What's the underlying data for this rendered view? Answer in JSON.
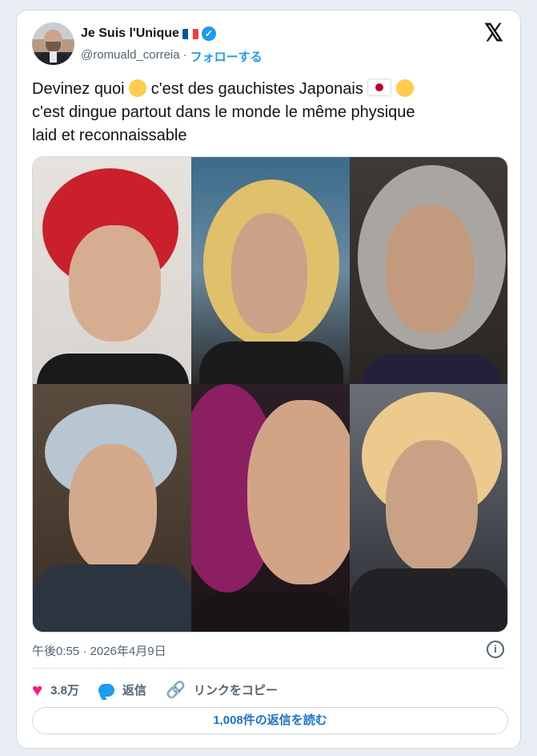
{
  "author": {
    "name": "Je Suis l'Unique",
    "handle": "@romuald_correia",
    "separator": "·",
    "follow_label": "フォローする",
    "flag_colors": [
      "#0055a4",
      "#ffffff",
      "#ef4135"
    ]
  },
  "tweet": {
    "line1_a": "Devinez quoi",
    "line1_b": "c'est des gauchistes Japonais",
    "line2": "c'est dingue partout dans le monde le même physique",
    "line3": "laid et reconnaissable",
    "emojis": [
      "shushing-face",
      "japan-flag",
      "rolling-on-floor-laughing"
    ]
  },
  "media": {
    "photos": [
      {
        "name": "red-hair-woman"
      },
      {
        "name": "blonde-streaked-person"
      },
      {
        "name": "gray-hair-woman"
      },
      {
        "name": "silver-hair-man"
      },
      {
        "name": "magenta-hair-woman"
      },
      {
        "name": "blonde-hair-man"
      }
    ]
  },
  "meta": {
    "timestamp": "午後0:55 · 2026年4月9日"
  },
  "actions": {
    "likes": "3.8万",
    "reply_label": "返信",
    "copy_link_label": "リンクをコピー"
  },
  "replies_button": "1,008件の返信を読む",
  "colors": {
    "accent": "#1d9bf0",
    "heart": "#f91880",
    "link_text": "#1d73c4"
  }
}
